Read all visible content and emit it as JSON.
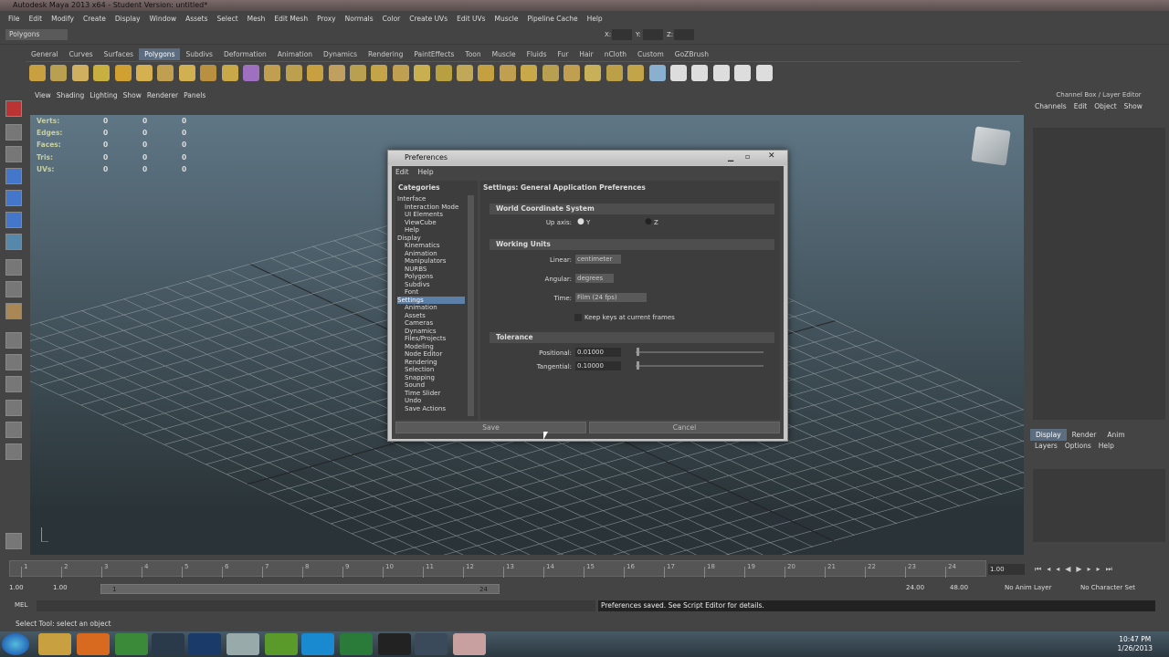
{
  "window": {
    "title": "Autodesk Maya 2013 x64 - Student Version: untitled*"
  },
  "menubar": [
    "File",
    "Edit",
    "Modify",
    "Create",
    "Display",
    "Window",
    "Assets",
    "Select",
    "Mesh",
    "Edit Mesh",
    "Proxy",
    "Normals",
    "Color",
    "Create UVs",
    "Edit UVs",
    "Muscle",
    "Pipeline Cache",
    "Help"
  ],
  "statusline": {
    "mode": "Polygons",
    "x": "X:",
    "y": "Y:",
    "z": "Z:"
  },
  "shelf_tabs": [
    "General",
    "Curves",
    "Surfaces",
    "Polygons",
    "Subdivs",
    "Deformation",
    "Animation",
    "Dynamics",
    "Rendering",
    "PaintEffects",
    "Toon",
    "Muscle",
    "Fluids",
    "Fur",
    "Hair",
    "nCloth",
    "Custom",
    "GoZBrush"
  ],
  "shelf_active": "Polygons",
  "viewport_menu": [
    "View",
    "Shading",
    "Lighting",
    "Show",
    "Renderer",
    "Panels"
  ],
  "hud": {
    "labels": [
      "Verts:",
      "Edges:",
      "Faces:",
      "Tris:",
      "UVs:"
    ],
    "values": [
      [
        "0",
        "0",
        "0"
      ],
      [
        "0",
        "0",
        "0"
      ],
      [
        "0",
        "0",
        "0"
      ],
      [
        "0",
        "0",
        "0"
      ],
      [
        "0",
        "0",
        "0"
      ]
    ]
  },
  "channel_box": {
    "title": "Channel Box / Layer Editor",
    "menu": [
      "Channels",
      "Edit",
      "Object",
      "Show"
    ],
    "layer_tabs": [
      "Display",
      "Render",
      "Anim"
    ],
    "layer_menu": [
      "Layers",
      "Options",
      "Help"
    ]
  },
  "time_slider": {
    "ticks": [
      "1",
      "2",
      "3",
      "4",
      "5",
      "6",
      "7",
      "8",
      "9",
      "10",
      "11",
      "12",
      "13",
      "14",
      "15",
      "16",
      "17",
      "18",
      "19",
      "20",
      "21",
      "22",
      "23",
      "24"
    ],
    "current": "1.00"
  },
  "range": {
    "start": "1.00",
    "start2": "1.00",
    "inner_start": "1",
    "inner_end": "24",
    "end": "24.00",
    "end2": "48.00",
    "anim_layer": "No Anim Layer",
    "char_set": "No Character Set"
  },
  "command": {
    "label": "MEL",
    "output": "Preferences saved. See Script Editor for details."
  },
  "help_line": "Select Tool: select an object",
  "clock": {
    "time": "10:47 PM",
    "date": "1/26/2013"
  },
  "dialog": {
    "title": "Preferences",
    "menu": [
      "Edit",
      "Help"
    ],
    "categories_title": "Categories",
    "categories": [
      {
        "label": "Interface",
        "indent": false
      },
      {
        "label": "Interaction Mode",
        "indent": true
      },
      {
        "label": "UI Elements",
        "indent": true
      },
      {
        "label": "ViewCube",
        "indent": true
      },
      {
        "label": "Help",
        "indent": true
      },
      {
        "label": "Display",
        "indent": false
      },
      {
        "label": "Kinematics",
        "indent": true
      },
      {
        "label": "Animation",
        "indent": true
      },
      {
        "label": "Manipulators",
        "indent": true
      },
      {
        "label": "NURBS",
        "indent": true
      },
      {
        "label": "Polygons",
        "indent": true
      },
      {
        "label": "Subdivs",
        "indent": true
      },
      {
        "label": "Font",
        "indent": true
      },
      {
        "label": "Settings",
        "indent": false,
        "selected": true
      },
      {
        "label": "Animation",
        "indent": true
      },
      {
        "label": "Assets",
        "indent": true
      },
      {
        "label": "Cameras",
        "indent": true
      },
      {
        "label": "Dynamics",
        "indent": true
      },
      {
        "label": "Files/Projects",
        "indent": true
      },
      {
        "label": "Modeling",
        "indent": true
      },
      {
        "label": "Node Editor",
        "indent": true
      },
      {
        "label": "Rendering",
        "indent": true
      },
      {
        "label": "Selection",
        "indent": true
      },
      {
        "label": "Snapping",
        "indent": true
      },
      {
        "label": "Sound",
        "indent": true
      },
      {
        "label": "Time Slider",
        "indent": true
      },
      {
        "label": "Undo",
        "indent": true
      },
      {
        "label": "Save Actions",
        "indent": true
      }
    ],
    "settings_title": "Settings: General Application Preferences",
    "world_section": "World Coordinate System",
    "up_axis_label": "Up axis:",
    "up_y": "Y",
    "up_z": "Z",
    "units_section": "Working Units",
    "linear_label": "Linear:",
    "linear_value": "centimeter",
    "angular_label": "Angular:",
    "angular_value": "degrees",
    "time_label": "Time:",
    "time_value": "Film (24 fps)",
    "keep_keys": "Keep keys at current frames",
    "tolerance_section": "Tolerance",
    "positional_label": "Positional:",
    "positional_value": "0.01000",
    "tangential_label": "Tangential:",
    "tangential_value": "0.10000",
    "save": "Save",
    "cancel": "Cancel"
  }
}
